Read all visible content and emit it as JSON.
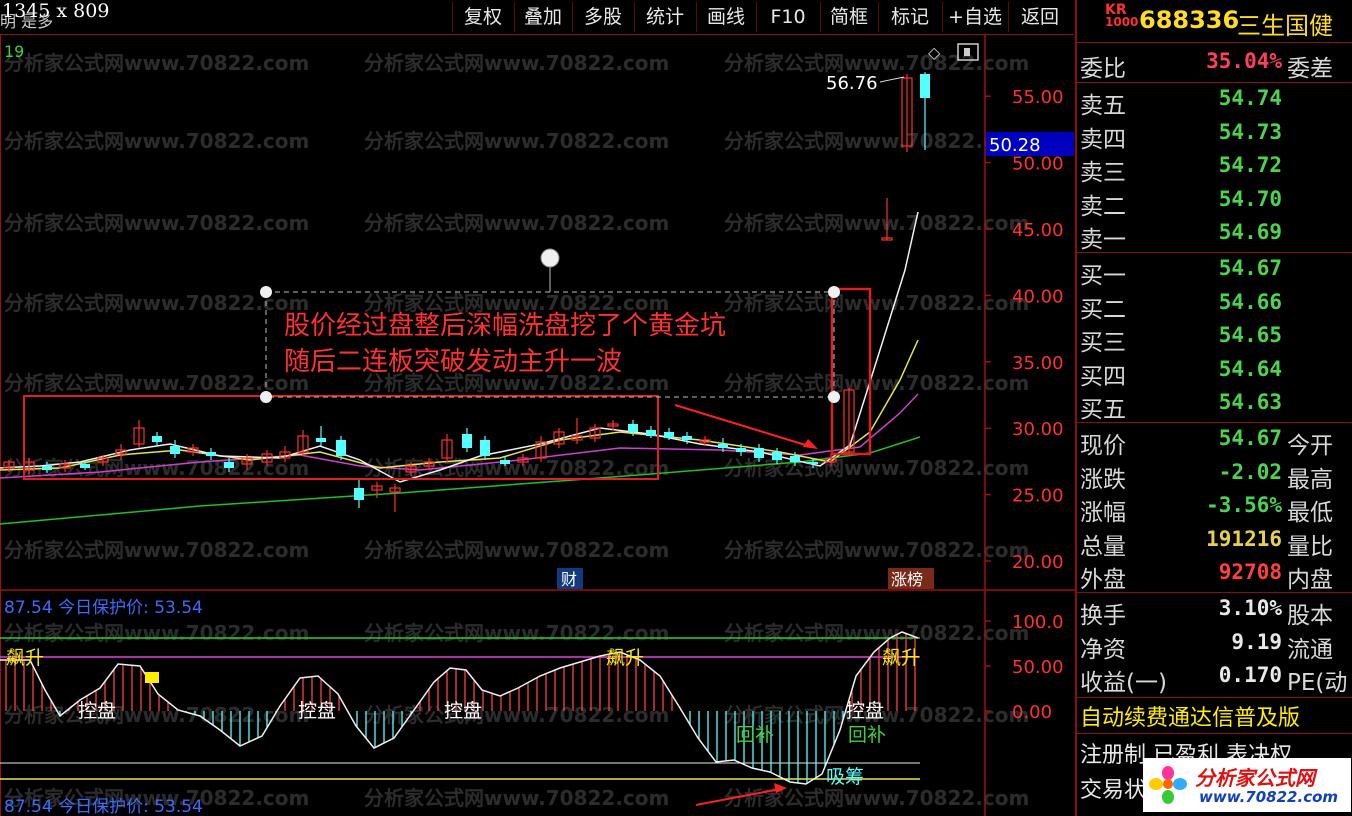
{
  "overlay": {
    "dimension_label": "1345 x 809"
  },
  "toolbar": {
    "period_label": "明 是多",
    "buttons": [
      "复权",
      "叠加",
      "多股",
      "统计",
      "画线",
      "F10",
      "简框",
      "标记",
      "+自选",
      "返回"
    ]
  },
  "stock": {
    "market_badge_top": "KR",
    "market_badge_bottom": "1000",
    "code": "688336",
    "name": "三生国健"
  },
  "price_chart": {
    "top_left_value": "19",
    "y_ticks": [
      "55.00",
      "50.00",
      "45.00",
      "40.00",
      "35.00",
      "30.00",
      "25.00",
      "20.00"
    ],
    "y_values": [
      55,
      50,
      45,
      40,
      35,
      30,
      25,
      20
    ],
    "current_price_label": "50.28",
    "high_label": "56.76",
    "annotation_line1": "股价经过盘整后深幅洗盘挖了个黄金坑",
    "annotation_line2": "随后二连板突破发动主升一波",
    "badge_cai": "财",
    "badge_zhangbang": "涨榜",
    "watermark": "分析家公式网www.70822.com"
  },
  "indicator": {
    "header": "87.54  今日保护价: 53.54",
    "header_bottom": "87.54  今日保护价: 53.54",
    "y_ticks": [
      "100.0",
      "50.00",
      "0.00"
    ],
    "y_values": [
      100,
      50,
      0
    ],
    "labels": {
      "piaosheng": "飙升",
      "kongpan": "控盘",
      "huibu": "回补",
      "xichou": "吸筹"
    }
  },
  "quote_panel": {
    "weibi": {
      "label": "委比",
      "value": "35.04%",
      "extra": "委差"
    },
    "sell": [
      {
        "label": "卖五",
        "value": "54.74"
      },
      {
        "label": "卖四",
        "value": "54.73"
      },
      {
        "label": "卖三",
        "value": "54.72"
      },
      {
        "label": "卖二",
        "value": "54.70"
      },
      {
        "label": "卖一",
        "value": "54.69"
      }
    ],
    "buy": [
      {
        "label": "买一",
        "value": "54.67"
      },
      {
        "label": "买二",
        "value": "54.66"
      },
      {
        "label": "买三",
        "value": "54.65"
      },
      {
        "label": "买四",
        "value": "54.64"
      },
      {
        "label": "买五",
        "value": "54.63"
      }
    ],
    "stats": [
      {
        "label": "现价",
        "value": "54.67",
        "extra": "今开",
        "color": "#4cd54c"
      },
      {
        "label": "涨跌",
        "value": "-2.02",
        "extra": "最高",
        "color": "#4cd54c"
      },
      {
        "label": "涨幅",
        "value": "-3.56%",
        "extra": "最低",
        "color": "#4cd54c"
      },
      {
        "label": "总量",
        "value": "191216",
        "extra": "量比",
        "color": "#e6d24a"
      },
      {
        "label": "外盘",
        "value": "92708",
        "extra": "内盘",
        "color": "#ff4040"
      }
    ],
    "finance": [
      {
        "label": "换手",
        "value": "3.10%",
        "extra": "股本"
      },
      {
        "label": "净资",
        "value": "9.19",
        "extra": "流通"
      },
      {
        "label": "收益(一)",
        "value": "0.170",
        "extra": "PE(动"
      }
    ],
    "banner1": "自动续费通达信普及版",
    "banner2": "注册制 已盈利 表决权",
    "banner3": "交易状",
    "logo_text": "分析家公式网",
    "logo_url": "www.70822.com"
  },
  "colors": {
    "up": "#ff3030",
    "down": "#54ffff",
    "red_frame": "#e02020",
    "green_value": "#4cd54c",
    "pink_value": "#ff3f5f",
    "axis": "#a01010"
  }
}
